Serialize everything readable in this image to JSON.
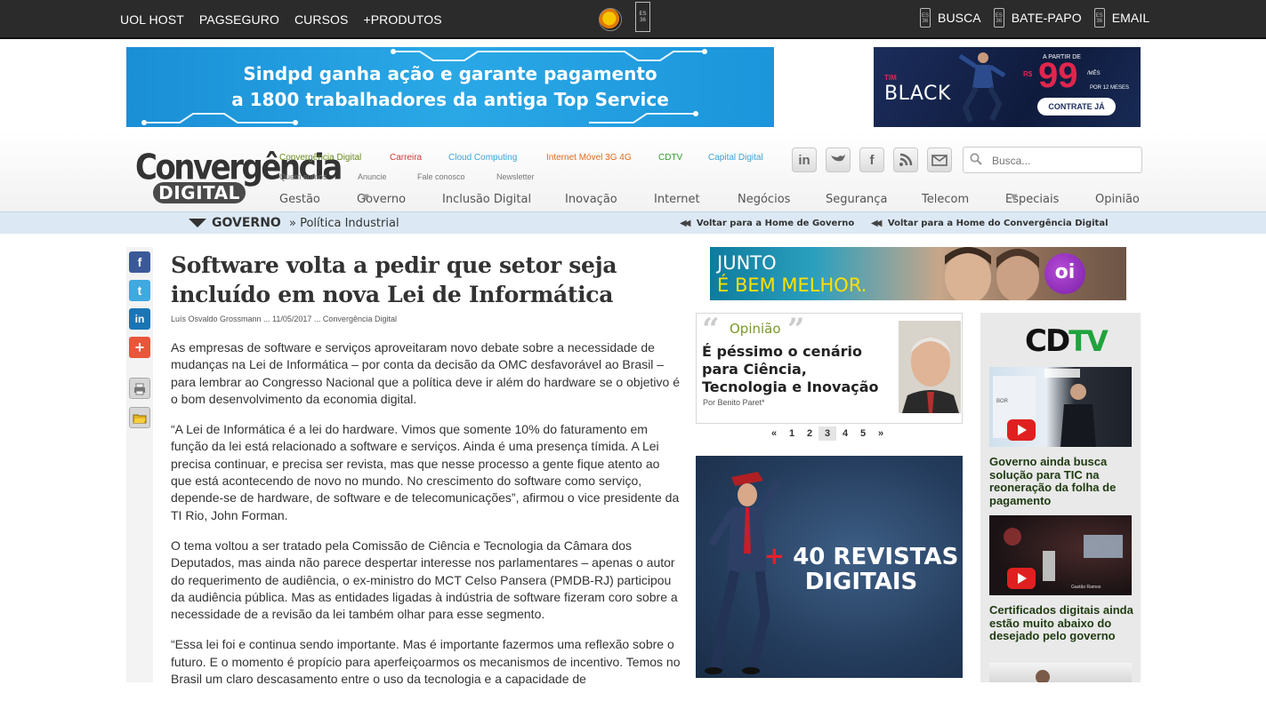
{
  "topbar": {
    "left_links": [
      "UOL HOST",
      "PAGSEGURO",
      "CURSOS",
      "+PRODUTOS"
    ],
    "right_links": [
      "BUSCA",
      "BATE-PAPO",
      "EMAIL"
    ],
    "mini_icon_text": "ES 36"
  },
  "banner_top": {
    "line1": "Sindpd ganha ação e garante pagamento",
    "line2": "a 1800 trabalhadores da antiga Top Service"
  },
  "banner_tim": {
    "brand_small": "TIM",
    "brand": "BLACK",
    "a_partir": "A PARTIR DE",
    "currency": "R$",
    "price": "99",
    "per_month": "/MÊS",
    "months": "POR 12 MESES",
    "cta": "CONTRATE JÁ"
  },
  "site": {
    "logo_line1": "Convergência",
    "logo_line2": "DIGITAL"
  },
  "sections": [
    {
      "label": "Convergência Digital",
      "color": "#6a8a1e"
    },
    {
      "label": "Carreira",
      "color": "#d23a3a"
    },
    {
      "label": "Cloud Computing",
      "color": "#3ba3d8"
    },
    {
      "label": "Internet Móvel 3G 4G",
      "color": "#e06b1a"
    },
    {
      "label": "CDTV",
      "color": "#2f9b2f"
    },
    {
      "label": "Capital Digital",
      "color": "#3ba3d8"
    }
  ],
  "sublinks": [
    "Quem somos",
    "Anuncie",
    "Fale conosco",
    "Newsletter"
  ],
  "social_icons": [
    "linkedin-icon",
    "twitter-icon",
    "facebook-icon",
    "rss-icon",
    "email-icon"
  ],
  "search": {
    "placeholder": "Busca..."
  },
  "mainnav": [
    {
      "label": "Gestão",
      "dropdown": false
    },
    {
      "label": "Governo",
      "dropdown": true
    },
    {
      "label": "Inclusão Digital",
      "dropdown": false
    },
    {
      "label": "Inovação",
      "dropdown": false
    },
    {
      "label": "Internet",
      "dropdown": false
    },
    {
      "label": "Negócios",
      "dropdown": false
    },
    {
      "label": "Segurança",
      "dropdown": false
    },
    {
      "label": "Telecom",
      "dropdown": false
    },
    {
      "label": "Especiais",
      "dropdown": true
    },
    {
      "label": "Opinião",
      "dropdown": false
    }
  ],
  "breadcrumb": {
    "section": "GOVERNO",
    "subsection": "» Política Industrial",
    "back_governo": "Voltar para a Home de Governo",
    "back_home": "Voltar para a Home do Convergência Digital"
  },
  "share_icons": [
    "facebook-share-icon",
    "twitter-share-icon",
    "linkedin-share-icon",
    "plus-share-icon",
    "print-icon",
    "folder-icon"
  ],
  "article": {
    "title": "Software volta a pedir que setor seja incluído em nova Lei de Informática",
    "byline": "Luís Osvaldo Grossmann ... 11/05/2017 ... Convergência Digital",
    "paragraphs": [
      "As empresas de software e serviços aproveitaram novo debate sobre a necessidade de mudanças na Lei de Informática – por conta da decisão da OMC desfavorável ao Brasil – para lembrar ao Congresso Nacional que a política deve ir além do hardware se o objetivo é o bom desenvolvimento da economia digital.",
      "“A Lei de Informática é a lei do hardware. Vimos que somente 10% do faturamento em função da lei está relacionado a software e serviços. Ainda é uma presença tímida. A Lei precisa continuar, e precisa ser revista, mas que nesse processo a gente fique atento ao que está acontecendo de novo no mundo. No crescimento do software como serviço, depende-se de hardware, de software e de telecomunicações”, afirmou o vice presidente da TI Rio, John Forman.",
      "O tema voltou a ser tratado pela Comissão de Ciência e Tecnologia da Câmara dos Deputados, mas ainda não parece despertar interesse nos parlamentares – apenas o autor do requerimento de audiência, o ex-ministro do MCT Celso Pansera (PMDB-RJ) participou da audiência pública. Mas as entidades ligadas à indústria de software fizeram coro sobre a necessidade de a revisão da lei também olhar para esse segmento.",
      "“Essa lei foi e continua sendo importante. Mas é importante fazermos uma reflexão sobre o futuro. E o momento é propício para aperfeiçoarmos os mecanismos de incentivo. Temos no Brasil um claro descasamento entre o uso da tecnologia e a capacidade de"
    ]
  },
  "ad_oi": {
    "line1": "JUNTO",
    "line2": "É BEM MELHOR.",
    "brand": "oi"
  },
  "opinion": {
    "tag": "Opinião",
    "title": "É péssimo o cenário para Ciência, Tecnologia e Inovação",
    "author": "Por Benito Paret*"
  },
  "pager": [
    "«",
    "1",
    "2",
    "3",
    "4",
    "5",
    "»"
  ],
  "pager_current": "3",
  "ad_revistas": {
    "plus": "+",
    "line1": "40 REVISTAS",
    "line2": "DIGITAIS"
  },
  "cdtv": {
    "logo_cd": "CD",
    "logo_tv": "TV",
    "videos": [
      {
        "caption": "Governo ainda busca solução para TIC na reoneração da folha de pagamento"
      },
      {
        "caption": "Certificados digitais ainda estão muito abaixo do desejado pelo governo"
      }
    ]
  }
}
